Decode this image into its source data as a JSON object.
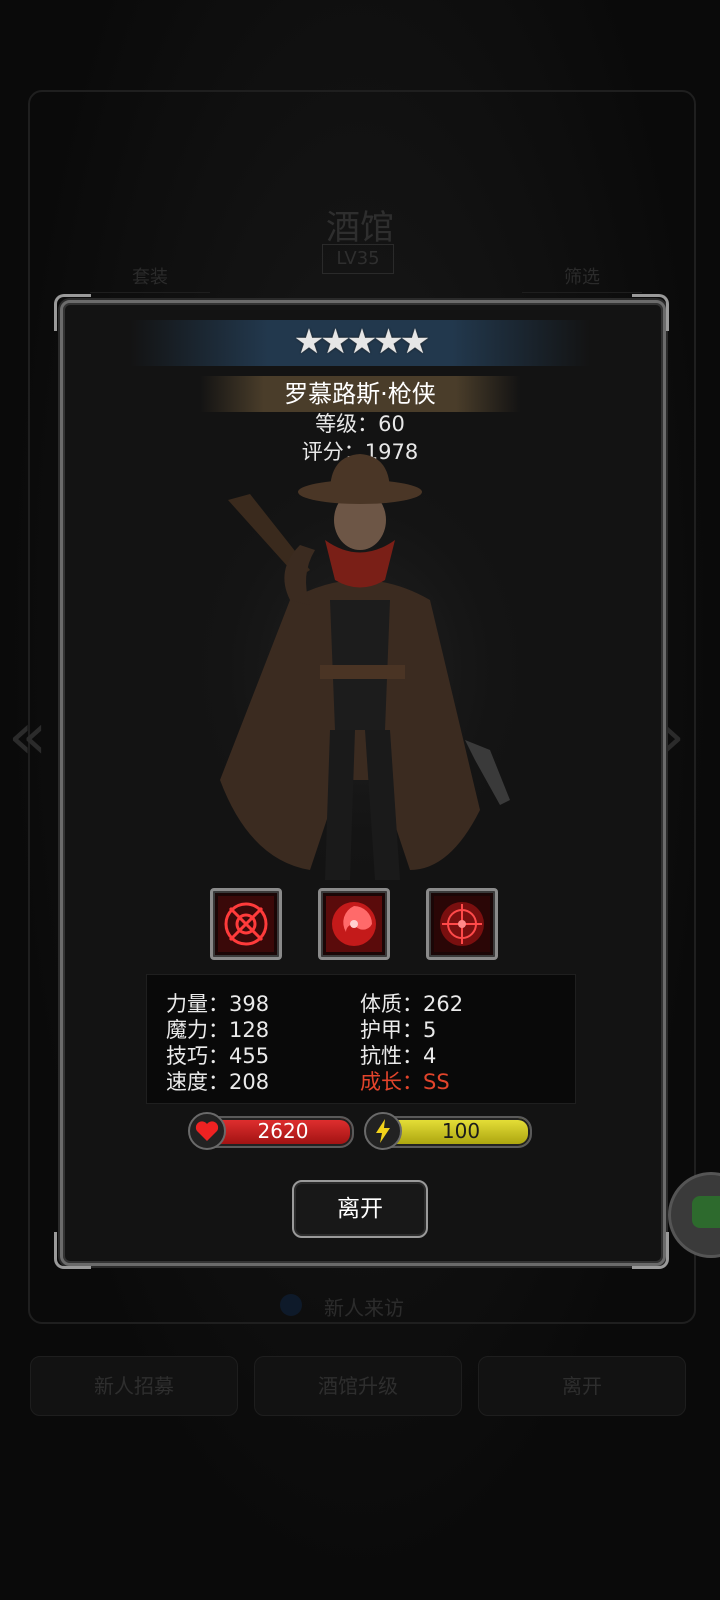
{
  "background": {
    "title": "酒馆",
    "level": "LV35",
    "left_button": "套装",
    "right_button": "筛选",
    "visit_text": "新人来访",
    "bottom_buttons": [
      "新人招募",
      "酒馆升级",
      "离开"
    ]
  },
  "hero": {
    "stars": 5,
    "stars_text": "★★★★★",
    "name": "罗慕路斯·枪侠",
    "level_line": "等级：60",
    "score_line": "评分：1978"
  },
  "skills": [
    {
      "icon": "crosshair-skill-icon"
    },
    {
      "icon": "swirl-skill-icon"
    },
    {
      "icon": "target-skill-icon"
    }
  ],
  "stats": {
    "strength": "力量：398",
    "magic": "魔力：128",
    "skill": "技巧：455",
    "speed": "速度：208",
    "constitution": "体质：262",
    "armor": "护甲：5",
    "resistance": "抗性：4",
    "growth": "成长：SS"
  },
  "bars": {
    "hp": "2620",
    "energy": "100"
  },
  "actions": {
    "leave": "离开"
  },
  "colors": {
    "growth": "#e2442b",
    "hp": "#d42424",
    "energy": "#d6cf23"
  }
}
